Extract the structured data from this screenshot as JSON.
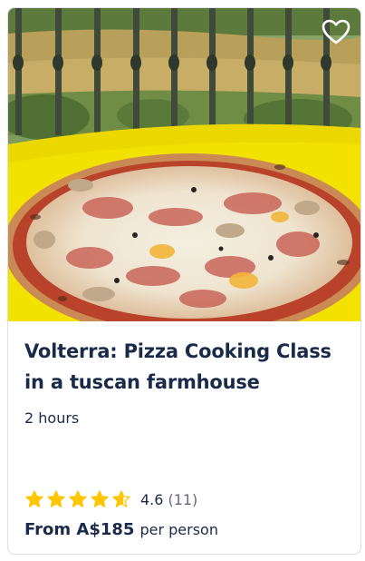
{
  "card": {
    "title": "Volterra: Pizza Cooking Class in a tuscan farmhouse",
    "duration": "2 hours",
    "rating": {
      "value": 4.6,
      "value_label": "4.6",
      "count_label": "(11)",
      "max_stars": 5
    },
    "price": {
      "label": "From A$185",
      "unit": "per person"
    },
    "wishlist_icon": "heart-outline-icon",
    "colors": {
      "title": "#1a2b49",
      "star": "#ffc600",
      "secondary_text": "#63687a",
      "tablecloth": "#f3e200"
    }
  }
}
